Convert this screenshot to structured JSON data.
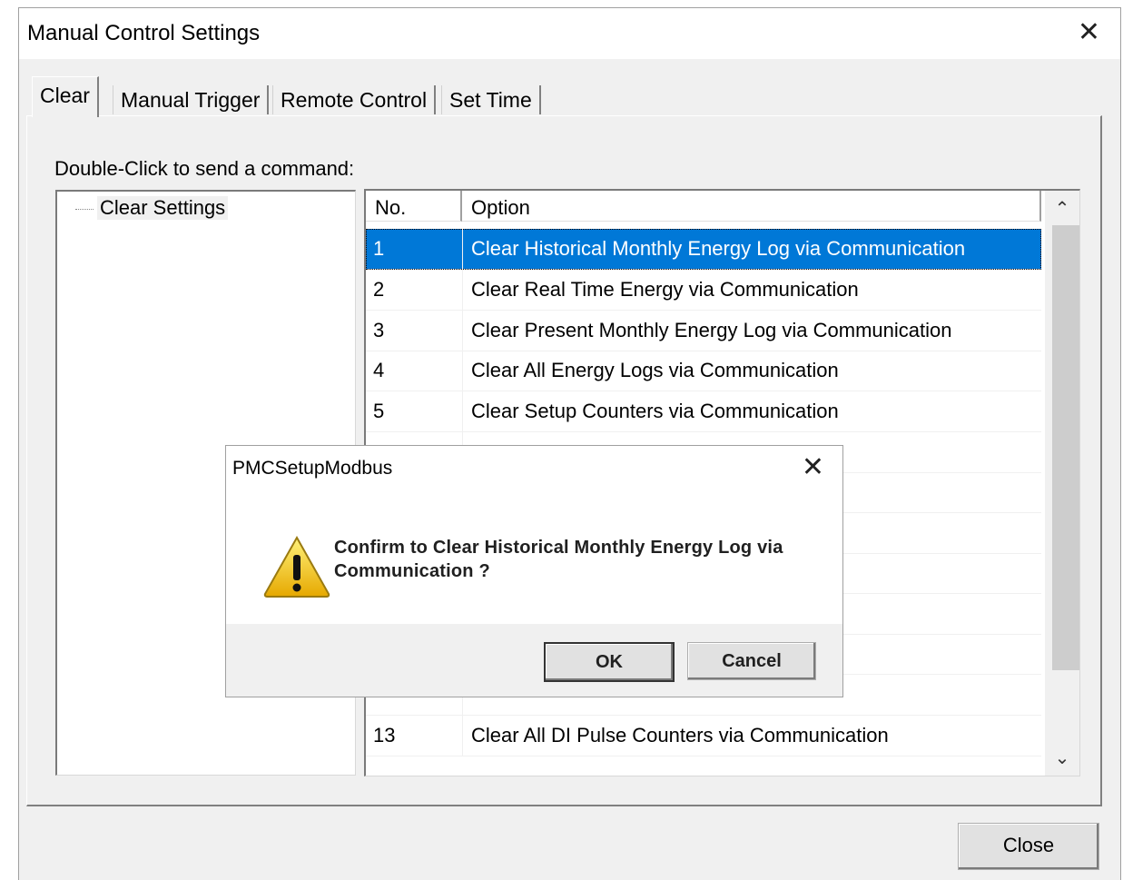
{
  "window": {
    "title": "Manual Control Settings"
  },
  "tabs": [
    {
      "label": "Clear",
      "active": true
    },
    {
      "label": "Manual Trigger",
      "active": false
    },
    {
      "label": "Remote Control",
      "active": false
    },
    {
      "label": "Set Time",
      "active": false
    }
  ],
  "instruction": "Double-Click to send a command:",
  "tree": {
    "root": "Clear Settings"
  },
  "list": {
    "headers": {
      "no": "No.",
      "option": "Option"
    },
    "rows": [
      {
        "no": "1",
        "option": "Clear Historical Monthly Energy Log via Communication",
        "selected": true
      },
      {
        "no": "2",
        "option": "Clear Real Time Energy via Communication"
      },
      {
        "no": "3",
        "option": "Clear Present Monthly Energy Log via Communication"
      },
      {
        "no": "4",
        "option": "Clear All Energy Logs via Communication"
      },
      {
        "no": "5",
        "option": "Clear Setup Counters via Communication"
      },
      {
        "no": "",
        "option": ""
      },
      {
        "no": "",
        "option": ""
      },
      {
        "no": "",
        "option": ""
      },
      {
        "no": "",
        "option": ""
      },
      {
        "no": "",
        "option": ""
      },
      {
        "no": "",
        "option": ""
      },
      {
        "no": "",
        "option": ""
      },
      {
        "no": "13",
        "option": "Clear All DI Pulse Counters via Communication"
      }
    ]
  },
  "footer": {
    "close_label": "Close"
  },
  "dialog": {
    "title": "PMCSetupModbus",
    "message_line1": "Confirm to  Clear Historical Monthly Energy Log via",
    "message_line2": "Communication ?",
    "ok_label": "OK",
    "cancel_label": "Cancel",
    "icon": "warning-icon"
  }
}
